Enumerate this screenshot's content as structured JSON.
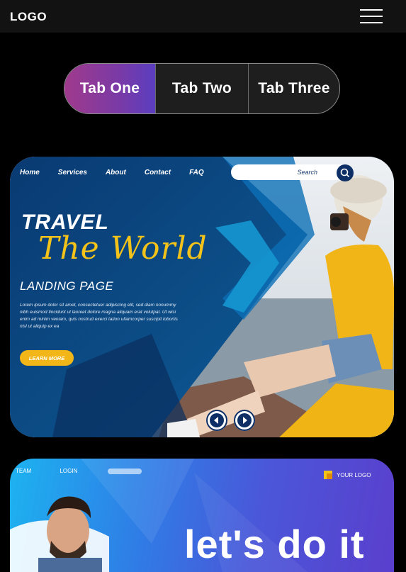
{
  "header": {
    "logo": "LOGO",
    "menu_icon": "hamburger-menu-icon"
  },
  "tabs": [
    {
      "label": "Tab One",
      "active": true
    },
    {
      "label": "Tab Two"
    },
    {
      "label": "Tab Three"
    }
  ],
  "banner1": {
    "nav": [
      "Home",
      "Services",
      "About",
      "Contact",
      "FAQ"
    ],
    "search_label": "Search",
    "title": "TRAVEL",
    "subtitle": "The World",
    "heading": "LANDING PAGE",
    "body": "Lorem ipsum dolor sit amet, consectetuer adipiscing elit, sed diam nonummy nibh euismod tincidunt ut laoreet dolore magna aliquam erat volutpat. Ut wisi enim ad minim veniam, quis nostrud exerci tation ullamcorper suscipit lobortis nisl ut aliquip ex ea",
    "cta": "LEARN MORE",
    "colors": {
      "accent": "#f2b619",
      "navy": "#0b3e74"
    }
  },
  "banner2": {
    "nav": [
      "TEAM",
      "LOGIN"
    ],
    "logo_text": "YOUR LOGO",
    "title": "let's do it"
  }
}
